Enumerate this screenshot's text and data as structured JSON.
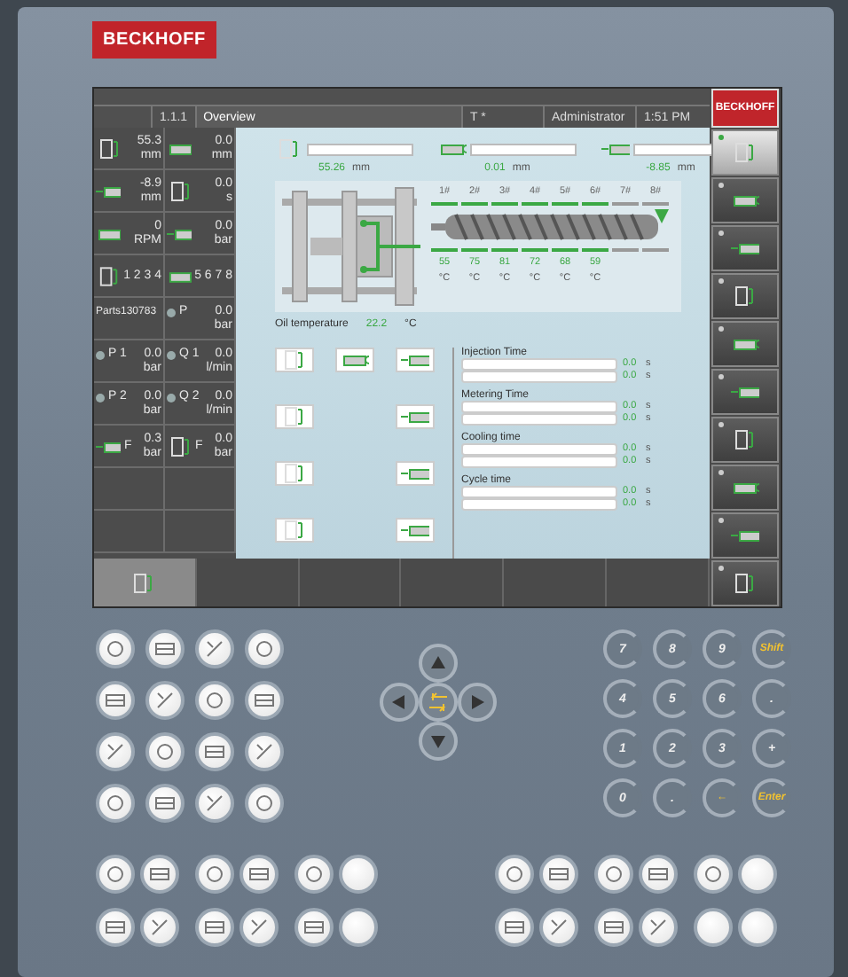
{
  "device_logo": "BECKHOFF",
  "screen": {
    "logo": "BECKHOFF",
    "tabs": [
      {
        "label": "1.1.1",
        "selected": false
      },
      {
        "label": "Overview",
        "selected": true
      },
      {
        "label": "T *",
        "selected": false
      },
      {
        "label": "Administrator",
        "selected": false
      },
      {
        "label": "1:51 PM",
        "selected": false
      }
    ],
    "status_cells": [
      {
        "kind": "icon",
        "value": "55.3",
        "unit": "mm"
      },
      {
        "kind": "icon",
        "value": "0.0",
        "unit": "mm"
      },
      {
        "kind": "icon",
        "value": "-8.9",
        "unit": "mm"
      },
      {
        "kind": "icon",
        "value": "0.0",
        "unit": "s"
      },
      {
        "kind": "icon",
        "value": "0",
        "unit": "RPM"
      },
      {
        "kind": "icon",
        "value": "0.0",
        "unit": "bar"
      },
      {
        "kind": "icon",
        "label": "1 2 3 4"
      },
      {
        "kind": "icon",
        "label": "5 6 7 8"
      },
      {
        "kind": "text",
        "label": "Parts130783"
      },
      {
        "kind": "dot",
        "label": "P",
        "value": "0.0",
        "unit": "bar"
      },
      {
        "kind": "dot",
        "label": "P 1",
        "value": "0.0",
        "unit": "bar"
      },
      {
        "kind": "dot",
        "label": "Q 1",
        "value": "0.0",
        "unit": "l/min"
      },
      {
        "kind": "dot",
        "label": "P 2",
        "value": "0.0",
        "unit": "bar"
      },
      {
        "kind": "dot",
        "label": "Q 2",
        "value": "0.0",
        "unit": "l/min"
      },
      {
        "kind": "icon",
        "label": "F",
        "value": "0.3",
        "unit": "bar"
      },
      {
        "kind": "icon",
        "label": "F",
        "value": "0.0",
        "unit": "bar"
      },
      {
        "kind": "empty"
      },
      {
        "kind": "empty"
      },
      {
        "kind": "empty"
      },
      {
        "kind": "empty"
      }
    ],
    "positions": [
      {
        "value": "55.26",
        "unit": "mm"
      },
      {
        "value": "0.01",
        "unit": "mm"
      },
      {
        "value": "-8.85",
        "unit": "mm"
      }
    ],
    "zones": [
      {
        "label": "1#",
        "on": true,
        "temp": "55",
        "unit": "°C"
      },
      {
        "label": "2#",
        "on": true,
        "temp": "75",
        "unit": "°C"
      },
      {
        "label": "3#",
        "on": true,
        "temp": "81",
        "unit": "°C"
      },
      {
        "label": "4#",
        "on": true,
        "temp": "72",
        "unit": "°C"
      },
      {
        "label": "5#",
        "on": true,
        "temp": "68",
        "unit": "°C"
      },
      {
        "label": "6#",
        "on": true,
        "temp": "59",
        "unit": "°C"
      },
      {
        "label": "7#",
        "on": false
      },
      {
        "label": "8#",
        "on": false
      }
    ],
    "oil": {
      "label": "Oil temperature",
      "value": "22.2",
      "unit": "°C"
    },
    "timers": [
      {
        "title": "Injection Time",
        "values": [
          "0.0",
          "0.0"
        ],
        "units": [
          "s",
          "s"
        ]
      },
      {
        "title": "Metering Time",
        "values": [
          "0.0",
          "0.0"
        ],
        "units": [
          "s",
          "s"
        ]
      },
      {
        "title": "Cooling time",
        "values": [
          "0.0",
          "0.0"
        ],
        "units": [
          "s",
          "s"
        ]
      },
      {
        "title": "Cycle time",
        "values": [
          "0.0",
          "0.0"
        ],
        "units": [
          "s",
          "s"
        ]
      }
    ],
    "softkeys": [
      {
        "selected": true
      },
      {
        "selected": false
      },
      {
        "selected": false
      },
      {
        "selected": false
      },
      {
        "selected": false
      },
      {
        "selected": false
      },
      {
        "selected": false
      },
      {
        "selected": false
      },
      {
        "selected": false
      },
      {
        "selected": false
      }
    ]
  },
  "numpad": [
    {
      "label": "7",
      "kind": "digit"
    },
    {
      "label": "8",
      "kind": "digit"
    },
    {
      "label": "9",
      "kind": "digit"
    },
    {
      "label": "Shift",
      "kind": "function"
    },
    {
      "label": "4",
      "kind": "digit"
    },
    {
      "label": "5",
      "kind": "digit"
    },
    {
      "label": "6",
      "kind": "digit"
    },
    {
      "label": ".",
      "kind": "digit"
    },
    {
      "label": "1",
      "kind": "digit"
    },
    {
      "label": "2",
      "kind": "digit"
    },
    {
      "label": "3",
      "kind": "digit"
    },
    {
      "label": "+",
      "kind": "digit"
    },
    {
      "label": "0",
      "kind": "digit"
    },
    {
      "label": ".",
      "kind": "digit"
    },
    {
      "label": "←",
      "kind": "function"
    },
    {
      "label": "Enter",
      "kind": "function"
    }
  ]
}
